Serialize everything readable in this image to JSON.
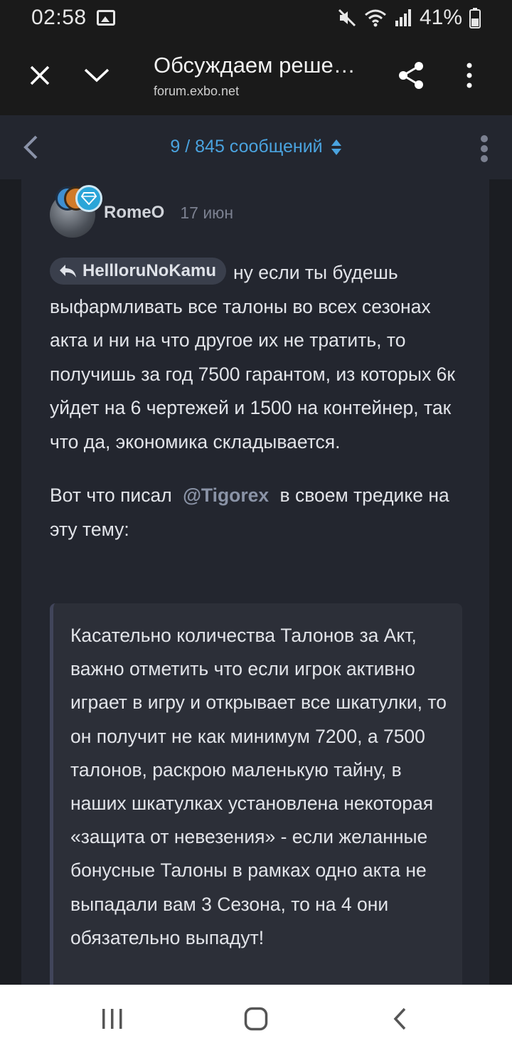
{
  "status_bar": {
    "time": "02:58",
    "battery": "41%"
  },
  "browser": {
    "title": "Обсуждаем реше…",
    "url": "forum.exbo.net"
  },
  "topic_bar": {
    "counter": "9 / 845 сообщений"
  },
  "post": {
    "username": "RomeO",
    "date": "17 июн",
    "reply_to": "HellloruNoKamu",
    "paragraph_1": "ну если ты будешь выфармливать все талоны во всех сезонах акта и ни на что другое их не тратить, то получишь за год 7500 гарантом, из которых 6к уйдет на 6 чертежей и 1500 на контейнер, так что да, экономика складывается.",
    "paragraph_2_before": "Вот что писал",
    "mention": "@Tigorex",
    "paragraph_2_after": "в своем тредике на эту тему:",
    "quote": "Касательно количества Талонов за Акт, важно отметить что если игрок активно играет в игру и открывает все шкатулки, то он получит не как минимум 7200, а 7500 талонов, раскрою маленькую тайну, в наших шкатулках установлена некоторая «защита от невезения» - если желанные бонусные Талоны в рамках одно акта не выпадали вам 3 Сезона, то на 4 они обязательно выпадут!"
  },
  "colors": {
    "accent": "#4aa3df",
    "background": "#1b1d22",
    "card": "#23262f"
  }
}
